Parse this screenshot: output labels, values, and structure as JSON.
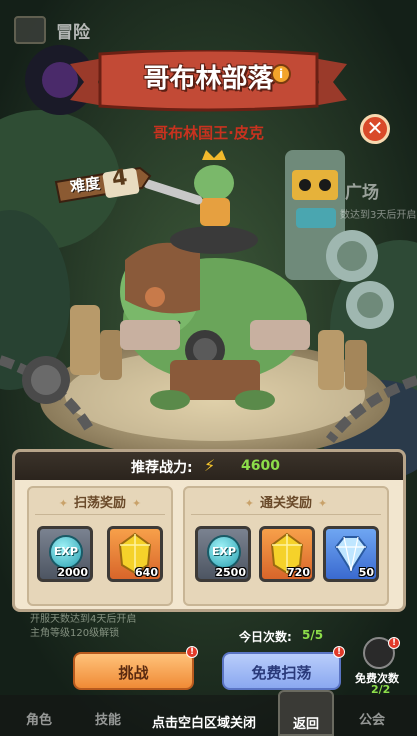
{
  "header": {
    "title": "冒险"
  },
  "banner": {
    "title": "哥布林部落",
    "info_icon": "i"
  },
  "boss": {
    "name": "哥布林国王·皮克"
  },
  "difficulty": {
    "label": "难度",
    "value": "4"
  },
  "background": {
    "square_label": "广场",
    "square_sub": "数达到3天后开启"
  },
  "power": {
    "label": "推荐战力:",
    "value": "4600"
  },
  "rewards": {
    "sweep": {
      "title": "扫荡奖励",
      "items": [
        {
          "icon": "exp-orb",
          "label": "EXP",
          "count": "2000",
          "rarity": "grey"
        },
        {
          "icon": "gold-gem",
          "count": "640",
          "rarity": "orange"
        }
      ]
    },
    "clear": {
      "title": "通关奖励",
      "items": [
        {
          "icon": "exp-orb",
          "label": "EXP",
          "count": "2500",
          "rarity": "grey"
        },
        {
          "icon": "gold-gem",
          "count": "720",
          "rarity": "orange"
        },
        {
          "icon": "blue-diamond",
          "count": "50",
          "rarity": "blue"
        }
      ]
    }
  },
  "unlock_hint": {
    "line1": "开服天数达到4天后开启",
    "line2": "主角等级120级解锁"
  },
  "daily": {
    "label": "今日次数:",
    "value": "5/5"
  },
  "buttons": {
    "challenge": "挑战",
    "free_sweep": "免费扫荡"
  },
  "free_count": {
    "label": "免费次数",
    "value": "2/2"
  },
  "nav": {
    "role": "角色",
    "skill": "技能",
    "hint": "点击空白区域关闭",
    "back": "返回",
    "guild": "公会"
  },
  "colors": {
    "accent": "#f08b36",
    "power_green": "#8cdc4a",
    "boss_red": "#c8321f"
  }
}
